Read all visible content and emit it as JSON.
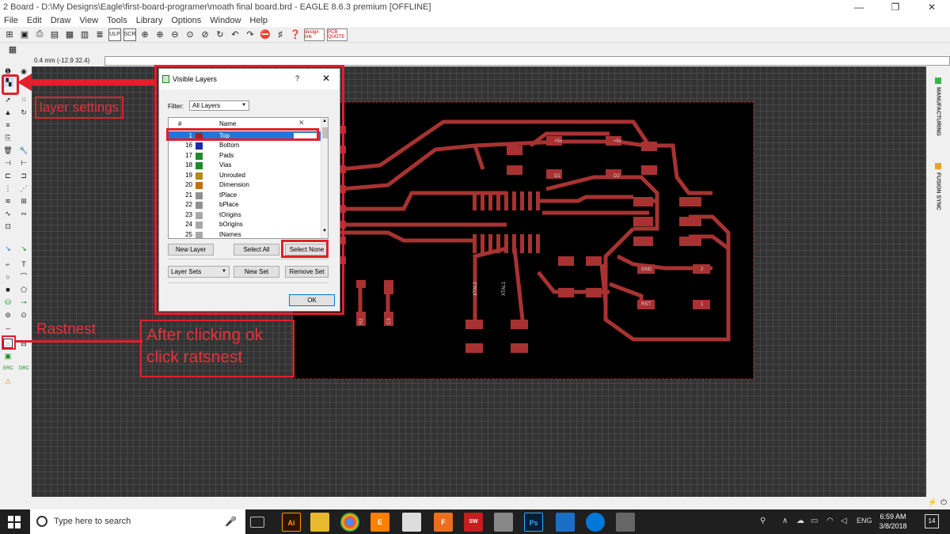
{
  "window": {
    "title": "2 Board - D:\\My Designs\\Eagle\\first-board-programer\\moath final board.brd - EAGLE 8.6.3 premium [OFFLINE]",
    "minimize": "—",
    "maximize": "❐",
    "close": "✕"
  },
  "menu": [
    "File",
    "Edit",
    "Draw",
    "View",
    "Tools",
    "Library",
    "Options",
    "Window",
    "Help"
  ],
  "toolbar": {
    "design_link": "design link",
    "pcb_quote": "PCB QUOTE"
  },
  "command_bar": {
    "coordinate": "0.4 mm (-12.9 32.4)"
  },
  "right_panel": {
    "manufacturing": "MANUFACTURING",
    "fusion_sync": "FUSION SYNC"
  },
  "dialog": {
    "title": "Visible Layers",
    "help": "?",
    "close": "✕",
    "filter_label": "Filter:",
    "filter_value": "All Layers",
    "columns": {
      "num": "#",
      "name": "Name",
      "x": "✕"
    },
    "layers": [
      {
        "num": "1",
        "name": "Top",
        "color": "#b01c1c",
        "selected": true
      },
      {
        "num": "16",
        "name": "Bottom",
        "color": "#1c2ab0"
      },
      {
        "num": "17",
        "name": "Pads",
        "color": "#1e8a2a"
      },
      {
        "num": "18",
        "name": "Vias",
        "color": "#1e8a2a"
      },
      {
        "num": "19",
        "name": "Unrouted",
        "color": "#b08a1c"
      },
      {
        "num": "20",
        "name": "Dimension",
        "color": "#c07010"
      },
      {
        "num": "21",
        "name": "tPlace",
        "color": "#909090"
      },
      {
        "num": "22",
        "name": "bPlace",
        "color": "#909090"
      },
      {
        "num": "23",
        "name": "tOrigins",
        "color": "#a8a8a8"
      },
      {
        "num": "24",
        "name": "bOrigins",
        "color": "#a8a8a8"
      },
      {
        "num": "25",
        "name": "tNames",
        "color": "#a8a8a8"
      }
    ],
    "buttons": {
      "new_layer": "New Layer",
      "select_all": "Select All",
      "select_none": "Select None",
      "layer_sets": "Layer Sets",
      "new_set": "New Set",
      "remove_set": "Remove Set",
      "ok": "OK"
    }
  },
  "annotations": {
    "layer_settings": "layer settings",
    "rastnest": "Rastnest",
    "after_ok_line1": "After clicking ok",
    "after_ok_line2": "click ratsnest"
  },
  "board": {
    "labels": [
      "+5v",
      "+5v",
      "D1",
      "D2",
      "GND",
      "2",
      "RST",
      "1",
      "XTAL2",
      "XTAL1",
      "R2",
      "C3"
    ]
  },
  "taskbar": {
    "search_placeholder": "Type here to search",
    "apps": [
      "Ai",
      "E",
      "F",
      "Ps"
    ],
    "tray_lang": "ENG",
    "time": "6:59 AM",
    "date": "3/8/2018",
    "notifications": "14"
  },
  "colors": {
    "annotation_red": "#e0202a",
    "copper": "#a83232",
    "canvas_bg": "#333333",
    "selection_blue": "#1f78d6"
  }
}
